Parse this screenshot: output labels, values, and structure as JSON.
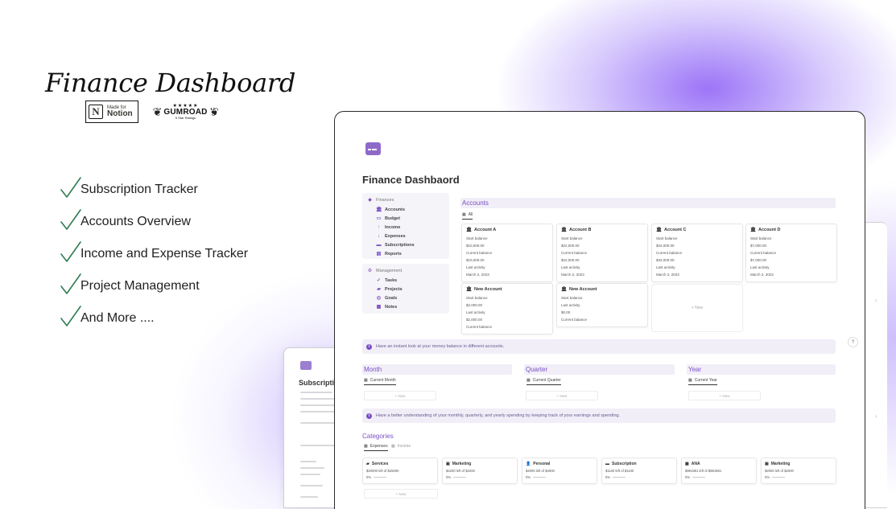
{
  "hero": {
    "title": "Finance Dashboard",
    "notion_badge": {
      "small": "Made for",
      "big": "Notion",
      "logo": "N"
    },
    "gumroad_badge": {
      "stars": "★★★★★",
      "word": "GUMROAD",
      "tiny": "5 Star Ratings"
    }
  },
  "features": [
    {
      "label": "Subscription Tracker"
    },
    {
      "label": "Accounts Overview"
    },
    {
      "label": "Income and Expense Tracker"
    },
    {
      "label": "Project Management"
    },
    {
      "label": "And More ...."
    }
  ],
  "back_window": {
    "title": "Subscription"
  },
  "app": {
    "page_title": "Finance Dashbaord",
    "sidebar": {
      "finances": {
        "heading": "Finances",
        "items": [
          {
            "label": "Accounts",
            "icon": "bank-icon"
          },
          {
            "label": "Budget",
            "icon": "wallet-icon"
          },
          {
            "label": "Income",
            "icon": "arrow-up-icon"
          },
          {
            "label": "Expenses",
            "icon": "arrow-down-icon"
          },
          {
            "label": "Subscriptions",
            "icon": "card-icon"
          },
          {
            "label": "Reports",
            "icon": "report-icon"
          }
        ]
      },
      "management": {
        "heading": "Management",
        "items": [
          {
            "label": "Tasks",
            "icon": "check-icon"
          },
          {
            "label": "Projects",
            "icon": "folder-icon"
          },
          {
            "label": "Goals",
            "icon": "target-icon"
          },
          {
            "label": "Notes",
            "icon": "note-icon"
          }
        ]
      }
    },
    "accounts": {
      "heading": "Accounts",
      "view_tab": "All",
      "cards": [
        {
          "name": "Account A",
          "rows": [
            "Start balance",
            "$10,000.00",
            "Current balance",
            "$10,000.00",
            "Last activity",
            "March 2, 2023"
          ]
        },
        {
          "name": "Account B",
          "rows": [
            "Start balance",
            "$22,000.00",
            "Current balance",
            "$22,000.00",
            "Last activity",
            "March 2, 2023"
          ]
        },
        {
          "name": "Account C",
          "rows": [
            "Start balance",
            "$34,000.00",
            "Current balance",
            "$34,000.00",
            "Last activity",
            "March 2, 2023"
          ]
        },
        {
          "name": "Account D",
          "rows": [
            "Start balance",
            "$7,000.00",
            "Current balance",
            "$7,000.00",
            "Last activity",
            "March 2, 2023"
          ]
        },
        {
          "name": "New Account",
          "rows": [
            "Start balance",
            "$2,000.00",
            "Last activity",
            "$2,000.00",
            "Current balance"
          ]
        },
        {
          "name": "New Account",
          "rows": [
            "Start balance",
            "Last activity",
            "$0.00",
            "Current balance"
          ]
        }
      ],
      "new_label": "+ New"
    },
    "callout_accounts": "Have an instant look at your money balance in different accounts.",
    "periods": [
      {
        "heading": "Month",
        "tab": "Current Month",
        "new_label": "+ New"
      },
      {
        "heading": "Quarter",
        "tab": "Current Quarter",
        "new_label": "+ New"
      },
      {
        "heading": "Year",
        "tab": "Current Year",
        "new_label": "+ New"
      }
    ],
    "callout_periods": "Have a better understanding of your monthly, quarterly, and yearly spending by keeping track of your earnings and spending.",
    "categories": {
      "heading": "Categories",
      "tabs": [
        {
          "label": "Expenses"
        },
        {
          "label": "Income"
        }
      ],
      "cards": [
        {
          "name": "Services",
          "amount": "$20000 left of $25000",
          "pct": "0%"
        },
        {
          "name": "Marketing",
          "amount": "$4200 left of $4200",
          "pct": "0%"
        },
        {
          "name": "Personal",
          "amount": "$4000 left of $4000",
          "pct": "0%"
        },
        {
          "name": "Subscription",
          "amount": "$1100 left of $1100",
          "pct": "0%"
        },
        {
          "name": "ANA",
          "amount": "$981981 left of $981981",
          "pct": "0%"
        },
        {
          "name": "Marketing",
          "amount": "$2000 left of $2000",
          "pct": "0%"
        }
      ],
      "new_label": "+ New"
    },
    "help_label": "?"
  },
  "colors": {
    "accent": "#7a4fc4",
    "check": "#2e7d4f",
    "glow": "#8b5cf6"
  }
}
